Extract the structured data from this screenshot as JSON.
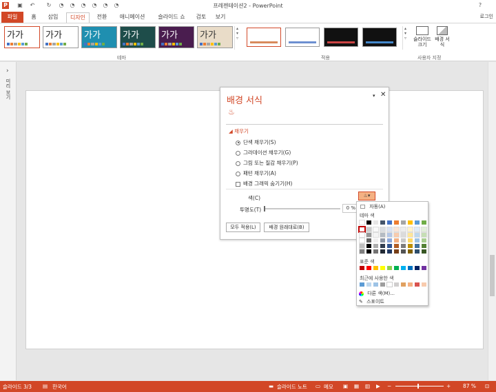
{
  "app": {
    "title": "프레젠테이션2 - PowerPoint",
    "login": "로그인"
  },
  "quick_access": [
    "save-icon",
    "undo-icon",
    "redo-icon"
  ],
  "tabs": [
    {
      "label": "파일"
    },
    {
      "label": "홈"
    },
    {
      "label": "삽입"
    },
    {
      "label": "디자인"
    },
    {
      "label": "전환"
    },
    {
      "label": "애니메이션"
    },
    {
      "label": "슬라이드 쇼"
    },
    {
      "label": "검토"
    },
    {
      "label": "보기"
    }
  ],
  "ribbon": {
    "themes": [
      {
        "label": "가가",
        "bg": "#ffffff",
        "fg": "#222222"
      },
      {
        "label": "가가",
        "bg": "#ffffff",
        "fg": "#222222"
      },
      {
        "label": "가가",
        "bg": "#1f8fb0",
        "fg": "#ffffff"
      },
      {
        "label": "가가",
        "bg": "#1e4d4a",
        "fg": "#ffffff"
      },
      {
        "label": "가가",
        "bg": "#4a1d4f",
        "fg": "#ffffff"
      },
      {
        "label": "가가",
        "bg": "#e9dcc8",
        "fg": "#333333"
      }
    ],
    "theme_group_label": "테마",
    "variant_group_label": "적용",
    "variants": [
      {
        "bg": "#ffffff",
        "accent": "#d88a5c"
      },
      {
        "bg": "#ffffff",
        "accent": "#6c8fd0"
      },
      {
        "bg": "#111111",
        "accent": "#cc4444"
      },
      {
        "bg": "#111111",
        "accent": "#4488cc"
      }
    ],
    "slide_size_label": "슬라이드 크기",
    "format_bg_label": "배경 서식",
    "custom_group_label": "사용자 지정"
  },
  "left_strip": {
    "label": "미리 보기"
  },
  "dialog": {
    "title": "배경 서식",
    "section": "채우기",
    "options": [
      {
        "label": "단색 채우기(S)",
        "selected": true
      },
      {
        "label": "그라데이션 채우기(G)",
        "selected": false
      },
      {
        "label": "그림 또는 질감 채우기(P)",
        "selected": false
      },
      {
        "label": "패턴 채우기(A)",
        "selected": false
      }
    ],
    "hide_bg_graphics": "배경 그래픽 숨기기(H)",
    "color_label": "색(C)",
    "transparency_label": "투명도(T)",
    "transparency_value": "0 %",
    "apply_all": "모두 적용(L)",
    "reset_bg": "배경 원래대로(B)"
  },
  "color_picker": {
    "auto": "자동(A)",
    "theme_colors_label": "테마 색",
    "theme_top": [
      "#ffffff",
      "#000000",
      "#e7e6e6",
      "#44546a",
      "#4472c4",
      "#ed7d31",
      "#a5a5a5",
      "#ffc000",
      "#5b9bd5",
      "#70ad47"
    ],
    "standard_label": "표준 색",
    "standard": [
      "#c00000",
      "#ff0000",
      "#ffc000",
      "#ffff00",
      "#92d050",
      "#00b050",
      "#00b0f0",
      "#0070c0",
      "#002060",
      "#7030a0"
    ],
    "recent_label": "최근에 사용한 색",
    "recent": [
      "#5b9bd5",
      "#bdd7ee",
      "#9dc3e6",
      "#9e9e9e",
      "#ffffff",
      "#d0cece",
      "#e0a060",
      "#f4b183",
      "#d9534f",
      "#f8cbad"
    ],
    "more_colors": "다른 색(M)...",
    "eyedropper": "스포이트"
  },
  "status": {
    "slide": "슬라이드 3/3",
    "lang": "한국어",
    "notes": "슬라이드 노트",
    "memo": "메모",
    "zoom": "87 %"
  }
}
